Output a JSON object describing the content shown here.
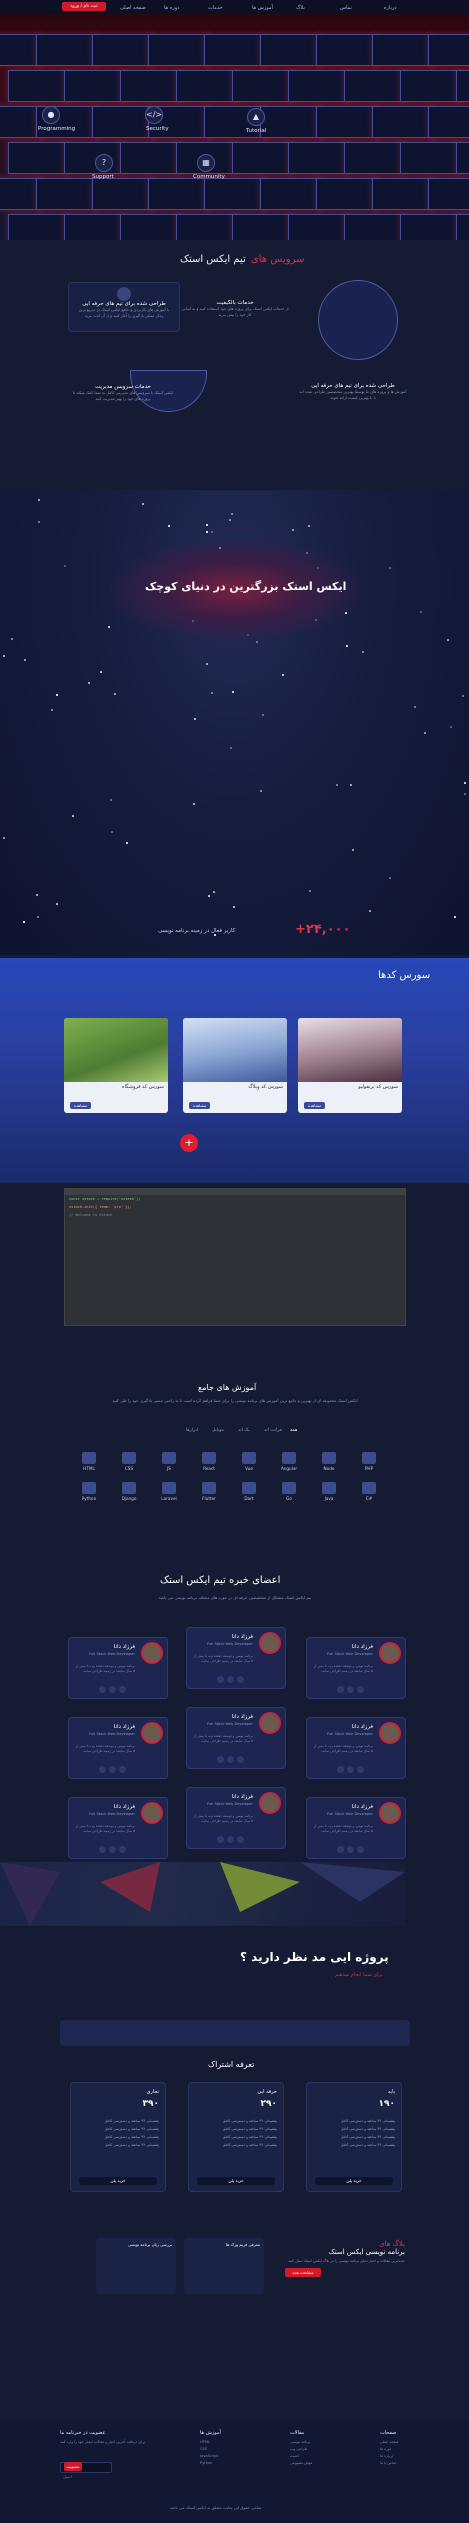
{
  "header": {
    "cta": "ثبت نام / ورود",
    "nav": [
      "صفحه اصلی",
      "دوره ها",
      "خدمات",
      "آموزش ها",
      "بلاگ",
      "تماس",
      "درباره"
    ]
  },
  "hero": {
    "items": [
      "Programming",
      "Security",
      "Tutorial",
      "Support",
      "Community"
    ]
  },
  "services": {
    "title_red": "سرویس های",
    "title_white": "تیم ایکس استک",
    "card1_title": "طراحی شده برای تیم های حرفه ایی",
    "card1_text": "با آموزش های کاربردی و جامع ایکس استک در سریع ترین زمان ممکن یادگیری را آغاز کنید و از آن لذت ببرید",
    "card2_title": "خدمات بالکیفیت",
    "card2_text": "از خدمات ایکس استک برای پروژه های خود استفاده کنید و به آسانی کار خود را پیش ببرید",
    "card3_title": "طراحی شده برای تیم های حرفه ایی",
    "card3_text": "آموزش ها و پروژه های ما توسط بهترین متخصصین طراحی شده اند تا با بهترین کیفیت ارائه شوند",
    "card4_title": "خدمات سرویس مدیریت",
    "card4_text": "ایکس استک با سرویس های مدیریتی کامل به شما کمک میکند تا پروژه های خود را بهتر مدیریت کنید"
  },
  "banner": {
    "headline": "ایکس استک بزرگترین در دنیای کوچک",
    "counter": "+۲۴,۰۰۰",
    "counter_label": "کاربر فعال در زمینه برنامه نویسی"
  },
  "codes": {
    "title": "سورس کدها",
    "cards": [
      {
        "name": "سورس کد فروشگاه",
        "btn": "مشاهده"
      },
      {
        "name": "سورس کد وبلاگ",
        "btn": "مشاهده"
      },
      {
        "name": "سورس کد پرتفولیو",
        "btn": "مشاهده"
      }
    ],
    "more": "+"
  },
  "terminal": {
    "lines": [
      "const xstack = require('xstack');",
      "xstack.init({ team: 'pro' });",
      "// Welcome to Xstack"
    ]
  },
  "courses": {
    "title": "آموزش های جامع",
    "subtitle": "ایکس استک مجموعه ای از بهترین و جامع ترین آموزش های برنامه نویسی را برای شما فراهم کرده است تا به راحتی مسیر یادگیری خود را طی کنید",
    "tabs": [
      "همه",
      "فرانت اند",
      "بک اند",
      "موبایل",
      "ابزارها"
    ],
    "items": [
      "HTML",
      "CSS",
      "JS",
      "React",
      "Vue",
      "Angular",
      "Node",
      "PHP",
      "Python",
      "Django",
      "Laravel",
      "Flutter",
      "Dart",
      "Go",
      "Java",
      "C#"
    ]
  },
  "team": {
    "title": "اعضای خبره تیم ایکس استک",
    "subtitle": "تیم ایکس استک متشکل از متخصصین حرفه ای در حوزه های مختلف برنامه نویسی می باشد",
    "member_name": "فرزاد دانا",
    "member_role": "Full Stack Web Developer",
    "member_text": "برنامه نویس و توسعه دهنده وب با بیش از ۵ سال سابقه در زمینه طراحی سایت",
    "count": 9
  },
  "project": {
    "title": "پروژه ایی مد نظر دارید ؟",
    "subtitle": "برای شما انجام میدهیم"
  },
  "pricing": {
    "title": "تعرفه اشتراک",
    "plans": [
      {
        "name": "پایه",
        "price": "۱۹۰",
        "btn": "خرید پلن"
      },
      {
        "name": "حرفه ایی",
        "price": "۲۹۰",
        "btn": "خرید پلن"
      },
      {
        "name": "تجاری",
        "price": "۳۹۰",
        "btn": "خرید پلن"
      }
    ],
    "feature": "پشتیبانی ۲۴ ساعته و دسترسی کامل"
  },
  "blog": {
    "title_red": "بلاگ های",
    "title_white": "برنامه نویسی ایکس استک",
    "text": "جدیدترین مقالات و اخبار دنیای برنامه نویسی را در بلاگ ایکس استک دنبال کنید",
    "btn": "مشاهده همه",
    "card1": "بررسی زبان برنامه نویسی",
    "card2": "معرفی فریم ورک ها"
  },
  "footer": {
    "cols": [
      {
        "head": "صفحات",
        "links": [
          "صفحه اصلی",
          "دوره ها",
          "درباره ما",
          "تماس با ما"
        ]
      },
      {
        "head": "مقالات",
        "links": [
          "برنامه نویسی",
          "طراحی وب",
          "امنیت",
          "هوش مصنوعی"
        ]
      },
      {
        "head": "آموزش ها",
        "links": [
          "HTML",
          "CSS",
          "JavaScript",
          "Python"
        ]
      },
      {
        "head": "عضویت در خبرنامه ما",
        "links": [
          "برای دریافت آخرین اخبار و مقالات ایمیل خود را وارد کنید"
        ]
      }
    ],
    "subscribe_btn": "عضویت",
    "email_placeholder": "ایمیل",
    "copyright": "تمامی حقوق این سایت متعلق به ایکس استک می باشد"
  }
}
